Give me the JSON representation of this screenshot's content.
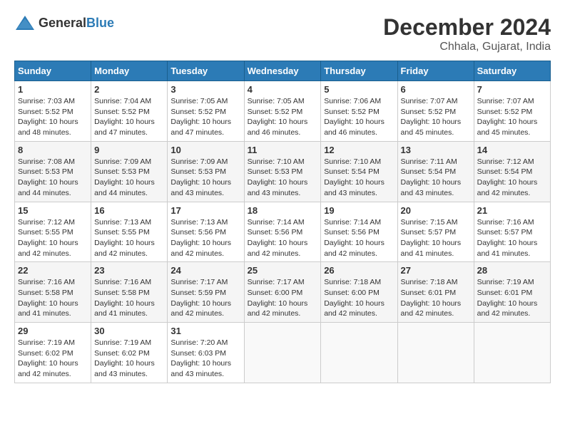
{
  "header": {
    "logo_general": "General",
    "logo_blue": "Blue",
    "month": "December 2024",
    "location": "Chhala, Gujarat, India"
  },
  "calendar": {
    "days_of_week": [
      "Sunday",
      "Monday",
      "Tuesday",
      "Wednesday",
      "Thursday",
      "Friday",
      "Saturday"
    ],
    "weeks": [
      [
        {
          "day": "",
          "info": ""
        },
        {
          "day": "2",
          "info": "Sunrise: 7:04 AM\nSunset: 5:52 PM\nDaylight: 10 hours\nand 47 minutes."
        },
        {
          "day": "3",
          "info": "Sunrise: 7:05 AM\nSunset: 5:52 PM\nDaylight: 10 hours\nand 47 minutes."
        },
        {
          "day": "4",
          "info": "Sunrise: 7:05 AM\nSunset: 5:52 PM\nDaylight: 10 hours\nand 46 minutes."
        },
        {
          "day": "5",
          "info": "Sunrise: 7:06 AM\nSunset: 5:52 PM\nDaylight: 10 hours\nand 46 minutes."
        },
        {
          "day": "6",
          "info": "Sunrise: 7:07 AM\nSunset: 5:52 PM\nDaylight: 10 hours\nand 45 minutes."
        },
        {
          "day": "7",
          "info": "Sunrise: 7:07 AM\nSunset: 5:52 PM\nDaylight: 10 hours\nand 45 minutes."
        }
      ],
      [
        {
          "day": "1",
          "info": "Sunrise: 7:03 AM\nSunset: 5:52 PM\nDaylight: 10 hours\nand 48 minutes."
        },
        {
          "day": "",
          "info": ""
        },
        {
          "day": "",
          "info": ""
        },
        {
          "day": "",
          "info": ""
        },
        {
          "day": "",
          "info": ""
        },
        {
          "day": "",
          "info": ""
        },
        {
          "day": "",
          "info": ""
        }
      ],
      [
        {
          "day": "8",
          "info": "Sunrise: 7:08 AM\nSunset: 5:53 PM\nDaylight: 10 hours\nand 44 minutes."
        },
        {
          "day": "9",
          "info": "Sunrise: 7:09 AM\nSunset: 5:53 PM\nDaylight: 10 hours\nand 44 minutes."
        },
        {
          "day": "10",
          "info": "Sunrise: 7:09 AM\nSunset: 5:53 PM\nDaylight: 10 hours\nand 43 minutes."
        },
        {
          "day": "11",
          "info": "Sunrise: 7:10 AM\nSunset: 5:53 PM\nDaylight: 10 hours\nand 43 minutes."
        },
        {
          "day": "12",
          "info": "Sunrise: 7:10 AM\nSunset: 5:54 PM\nDaylight: 10 hours\nand 43 minutes."
        },
        {
          "day": "13",
          "info": "Sunrise: 7:11 AM\nSunset: 5:54 PM\nDaylight: 10 hours\nand 43 minutes."
        },
        {
          "day": "14",
          "info": "Sunrise: 7:12 AM\nSunset: 5:54 PM\nDaylight: 10 hours\nand 42 minutes."
        }
      ],
      [
        {
          "day": "15",
          "info": "Sunrise: 7:12 AM\nSunset: 5:55 PM\nDaylight: 10 hours\nand 42 minutes."
        },
        {
          "day": "16",
          "info": "Sunrise: 7:13 AM\nSunset: 5:55 PM\nDaylight: 10 hours\nand 42 minutes."
        },
        {
          "day": "17",
          "info": "Sunrise: 7:13 AM\nSunset: 5:56 PM\nDaylight: 10 hours\nand 42 minutes."
        },
        {
          "day": "18",
          "info": "Sunrise: 7:14 AM\nSunset: 5:56 PM\nDaylight: 10 hours\nand 42 minutes."
        },
        {
          "day": "19",
          "info": "Sunrise: 7:14 AM\nSunset: 5:56 PM\nDaylight: 10 hours\nand 42 minutes."
        },
        {
          "day": "20",
          "info": "Sunrise: 7:15 AM\nSunset: 5:57 PM\nDaylight: 10 hours\nand 41 minutes."
        },
        {
          "day": "21",
          "info": "Sunrise: 7:16 AM\nSunset: 5:57 PM\nDaylight: 10 hours\nand 41 minutes."
        }
      ],
      [
        {
          "day": "22",
          "info": "Sunrise: 7:16 AM\nSunset: 5:58 PM\nDaylight: 10 hours\nand 41 minutes."
        },
        {
          "day": "23",
          "info": "Sunrise: 7:16 AM\nSunset: 5:58 PM\nDaylight: 10 hours\nand 41 minutes."
        },
        {
          "day": "24",
          "info": "Sunrise: 7:17 AM\nSunset: 5:59 PM\nDaylight: 10 hours\nand 42 minutes."
        },
        {
          "day": "25",
          "info": "Sunrise: 7:17 AM\nSunset: 6:00 PM\nDaylight: 10 hours\nand 42 minutes."
        },
        {
          "day": "26",
          "info": "Sunrise: 7:18 AM\nSunset: 6:00 PM\nDaylight: 10 hours\nand 42 minutes."
        },
        {
          "day": "27",
          "info": "Sunrise: 7:18 AM\nSunset: 6:01 PM\nDaylight: 10 hours\nand 42 minutes."
        },
        {
          "day": "28",
          "info": "Sunrise: 7:19 AM\nSunset: 6:01 PM\nDaylight: 10 hours\nand 42 minutes."
        }
      ],
      [
        {
          "day": "29",
          "info": "Sunrise: 7:19 AM\nSunset: 6:02 PM\nDaylight: 10 hours\nand 42 minutes."
        },
        {
          "day": "30",
          "info": "Sunrise: 7:19 AM\nSunset: 6:02 PM\nDaylight: 10 hours\nand 43 minutes."
        },
        {
          "day": "31",
          "info": "Sunrise: 7:20 AM\nSunset: 6:03 PM\nDaylight: 10 hours\nand 43 minutes."
        },
        {
          "day": "",
          "info": ""
        },
        {
          "day": "",
          "info": ""
        },
        {
          "day": "",
          "info": ""
        },
        {
          "day": "",
          "info": ""
        }
      ]
    ]
  }
}
